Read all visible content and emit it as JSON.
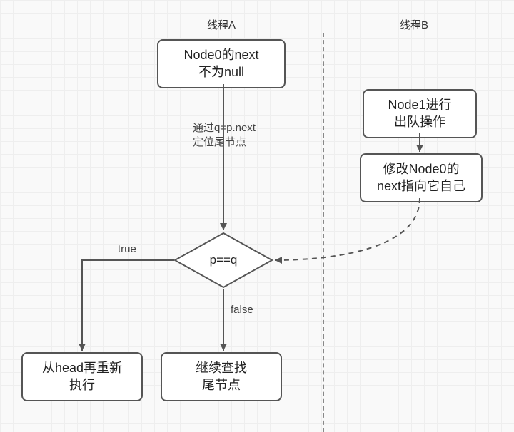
{
  "headers": {
    "threadA": "线程A",
    "threadB": "线程B"
  },
  "nodes": {
    "a_start": {
      "l1": "Node0的next",
      "l2": "不为null"
    },
    "a_decision": "p==q",
    "a_true": {
      "l1": "从head再重新",
      "l2": "执行"
    },
    "a_false": {
      "l1": "继续查找",
      "l2": "尾节点"
    },
    "b_start": {
      "l1": "Node1进行",
      "l2": "出队操作"
    },
    "b_next": {
      "l1": "修改Node0的",
      "l2": "next指向它自己"
    }
  },
  "edges": {
    "a_start_to_dec": {
      "l1": "通过q=p.next",
      "l2": "定位尾节点"
    },
    "dec_true": "true",
    "dec_false": "false"
  }
}
